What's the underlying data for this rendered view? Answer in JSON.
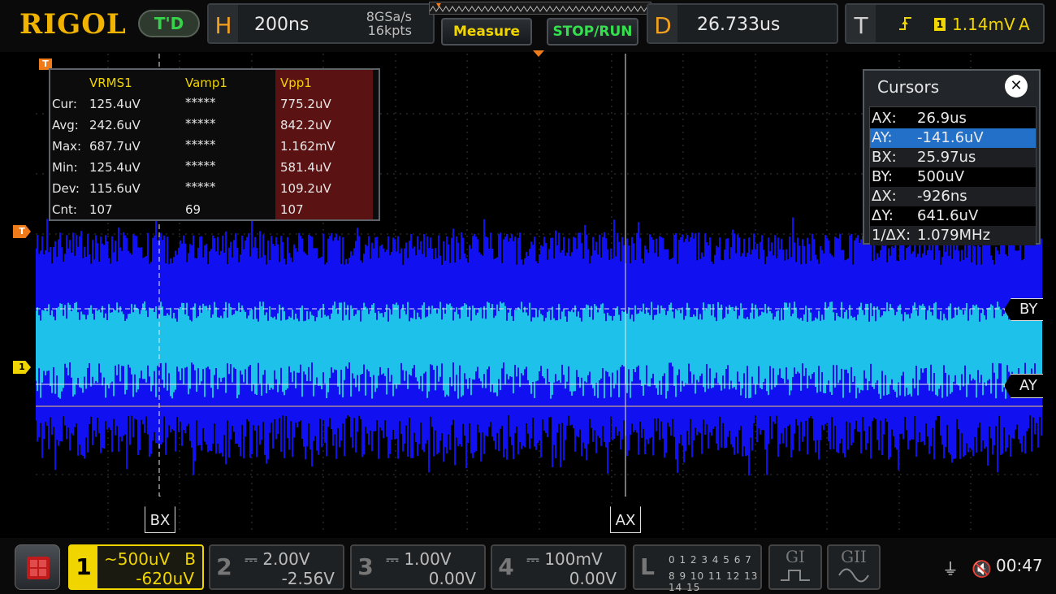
{
  "brand": "RIGOL",
  "top": {
    "td_label": "T'D",
    "horizontal": {
      "letter": "H",
      "timebase": "200ns",
      "sample_rate": "8GSa/s",
      "mem_depth": "16kpts"
    },
    "buttons": {
      "measure": "Measure",
      "stop_run": "STOP/RUN"
    },
    "delay": {
      "letter": "D",
      "value": "26.733us"
    },
    "trigger": {
      "letter": "T",
      "edge_icon": "rising-edge-icon",
      "source": "1",
      "level": "1.14mV",
      "mode": "A"
    }
  },
  "screen": {
    "markers": {
      "top": "T",
      "trigger_level": "T",
      "ch1": "1"
    },
    "cursor_tags": {
      "by": "BY",
      "ay": "AY",
      "bx": "BX",
      "ax": "AX"
    }
  },
  "measurements": {
    "headers": [
      "VRMS1",
      "Vamp1",
      "Vpp1"
    ],
    "rows": [
      {
        "label": "Cur:",
        "values": [
          "125.4uV",
          "*****",
          "775.2uV"
        ]
      },
      {
        "label": "Avg:",
        "values": [
          "242.6uV",
          "*****",
          "842.2uV"
        ]
      },
      {
        "label": "Max:",
        "values": [
          "687.7uV",
          "*****",
          "1.162mV"
        ]
      },
      {
        "label": "Min:",
        "values": [
          "125.4uV",
          "*****",
          "581.4uV"
        ]
      },
      {
        "label": "Dev:",
        "values": [
          "115.6uV",
          "*****",
          "109.2uV"
        ]
      },
      {
        "label": "Cnt:",
        "values": [
          "107",
          "69",
          "107"
        ]
      }
    ]
  },
  "cursors": {
    "title": "Cursors",
    "close_icon": "close-icon",
    "items": [
      {
        "key": "AX:",
        "value": "26.9us"
      },
      {
        "key": "AY:",
        "value": "-141.6uV"
      },
      {
        "key": "BX:",
        "value": "25.97us"
      },
      {
        "key": "BY:",
        "value": "500uV"
      },
      {
        "key": "ΔX:",
        "value": "-926ns"
      },
      {
        "key": "ΔY:",
        "value": "641.6uV"
      },
      {
        "key": "1/ΔX:",
        "value": "1.079MHz"
      }
    ],
    "selected_index": 1
  },
  "channels": [
    {
      "num": "1",
      "scale": "~500uV",
      "bw": "B",
      "offset": "-620uV"
    },
    {
      "num": "2",
      "scale": "⎓ 2.00V",
      "offset": "-2.56V"
    },
    {
      "num": "3",
      "scale": "⎓ 1.00V",
      "offset": "0.00V"
    },
    {
      "num": "4",
      "scale": "⎓ 100mV",
      "offset": "0.00V"
    }
  ],
  "logic": {
    "label": "L",
    "row1": "0 1 2 3  4 5 6 7",
    "row2": "8 9 10 11 12 13 14 15"
  },
  "decoders": [
    "GI",
    "GII"
  ],
  "status": {
    "usb_icon": "usb-icon",
    "mute_icon": "speaker-muted-icon",
    "time": "00:47"
  },
  "colors": {
    "ch1": "#f1d500",
    "trace_dark": "#1010f0",
    "trace_bright": "#20e0e8",
    "trigger": "#f07b1a"
  }
}
